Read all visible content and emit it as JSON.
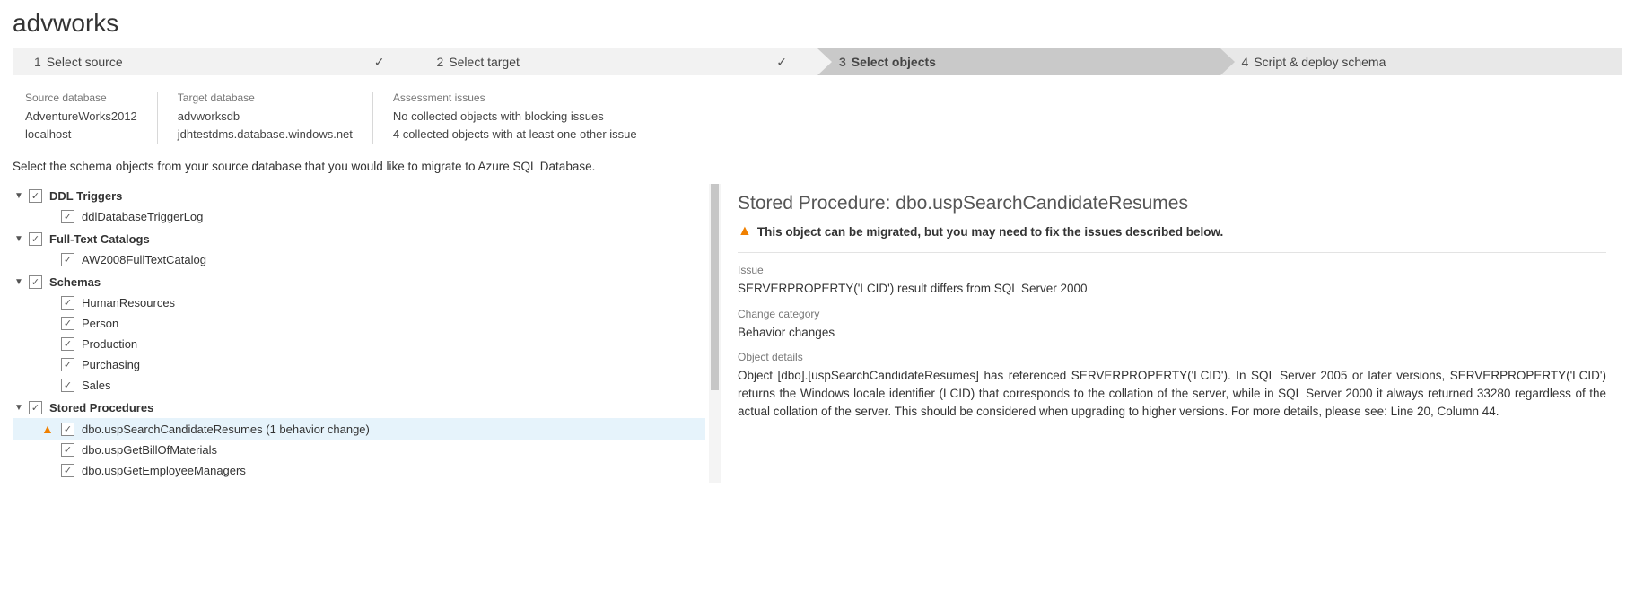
{
  "title": "advworks",
  "steps": [
    {
      "num": "1",
      "label": "Select source",
      "done": true,
      "cls": "bg0"
    },
    {
      "num": "2",
      "label": "Select target",
      "done": true,
      "cls": "bg0"
    },
    {
      "num": "3",
      "label": "Select objects",
      "done": false,
      "cls": "active"
    },
    {
      "num": "4",
      "label": "Script & deploy schema",
      "done": false,
      "cls": "bg1"
    }
  ],
  "info": {
    "source": {
      "label": "Source database",
      "db": "AdventureWorks2012",
      "server": "localhost"
    },
    "target": {
      "label": "Target database",
      "db": "advworksdb",
      "server": "jdhtestdms.database.windows.net"
    },
    "issues": {
      "label": "Assessment issues",
      "line1": "No collected objects with blocking issues",
      "line2": "4 collected objects with at least one other issue"
    }
  },
  "instruction": "Select the schema objects from your source database that you would like to migrate to Azure SQL Database.",
  "tree": [
    {
      "name": "DDL Triggers",
      "items": [
        {
          "label": "ddlDatabaseTriggerLog"
        }
      ]
    },
    {
      "name": "Full-Text Catalogs",
      "items": [
        {
          "label": "AW2008FullTextCatalog"
        }
      ]
    },
    {
      "name": "Schemas",
      "items": [
        {
          "label": "HumanResources"
        },
        {
          "label": "Person"
        },
        {
          "label": "Production"
        },
        {
          "label": "Purchasing"
        },
        {
          "label": "Sales"
        }
      ]
    },
    {
      "name": "Stored Procedures",
      "items": [
        {
          "label": "dbo.uspSearchCandidateResumes (1 behavior change)",
          "warn": true,
          "selected": true
        },
        {
          "label": "dbo.uspGetBillOfMaterials"
        },
        {
          "label": "dbo.uspGetEmployeeManagers"
        }
      ]
    }
  ],
  "detail": {
    "heading": "Stored Procedure: dbo.uspSearchCandidateResumes",
    "warn": "This object can be migrated, but you may need to fix the issues described below.",
    "issue_label": "Issue",
    "issue": "SERVERPROPERTY('LCID') result differs from SQL Server 2000",
    "cat_label": "Change category",
    "cat": "Behavior changes",
    "det_label": "Object details",
    "det": "Object [dbo].[uspSearchCandidateResumes] has referenced SERVERPROPERTY('LCID'). In SQL Server 2005 or later versions, SERVERPROPERTY('LCID') returns the Windows locale identifier (LCID) that corresponds to the collation of the server, while in SQL Server 2000 it always returned 33280 regardless of the actual collation of the server. This should be considered when upgrading to higher versions. For more details, please see: Line 20, Column 44."
  }
}
